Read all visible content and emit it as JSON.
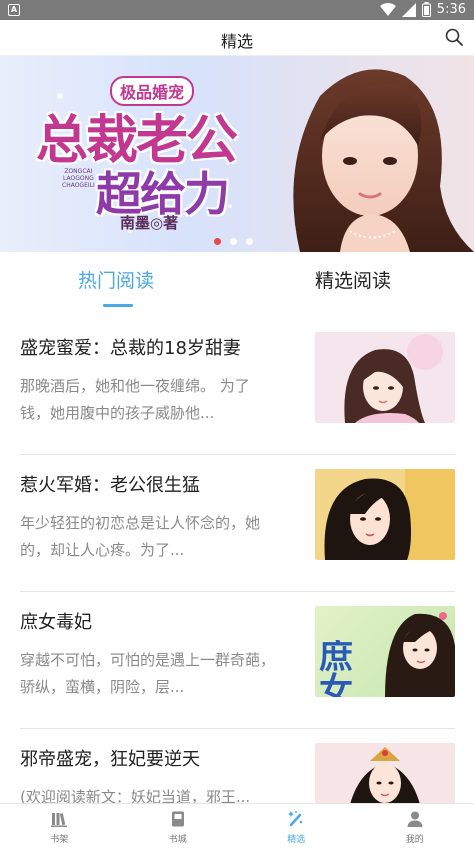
{
  "status_bar": {
    "time": "5:36",
    "app_badge": "A"
  },
  "header": {
    "title": "精选"
  },
  "banner": {
    "tag": "极品婚宠",
    "title_line1": "总裁老公",
    "pinyin_line1": "ZONGCAI",
    "pinyin_line2": "LAOGONG",
    "pinyin_line3": "CHAOGEILI",
    "title_line2": "超给力",
    "author": "南墨◎著",
    "page_count": 3,
    "active_page": 1
  },
  "tabs": {
    "hot": "热门阅读",
    "featured": "精选阅读"
  },
  "books": [
    {
      "title": "盛宠蜜爱：总裁的18岁甜妻",
      "desc": "那晚酒后，她和他一夜缠绵。 为了钱，她用腹中的孩子威胁他..."
    },
    {
      "title": "惹火军婚：老公很生猛",
      "desc": "年少轻狂的初恋总是让人怀念的，她的，却让人心疼。为了..."
    },
    {
      "title": "庶女毒妃",
      "desc": "穿越不可怕，可怕的是遇上一群奇葩，骄纵，蛮横，阴险，层...",
      "cover_text": "庶女"
    },
    {
      "title": "邪帝盛宠，狂妃要逆天",
      "desc": "(欢迎阅读新文：妖妃当道，邪王..."
    }
  ],
  "bottom_nav": [
    {
      "label": "书架",
      "icon": "bookshelf-icon"
    },
    {
      "label": "书城",
      "icon": "bookstore-icon"
    },
    {
      "label": "精选",
      "icon": "magic-wand-icon",
      "active": true
    },
    {
      "label": "我的",
      "icon": "user-icon"
    }
  ],
  "colors": {
    "accent": "#4aa8e6",
    "banner_title": "#c2378f",
    "active_dot": "#e53935"
  }
}
